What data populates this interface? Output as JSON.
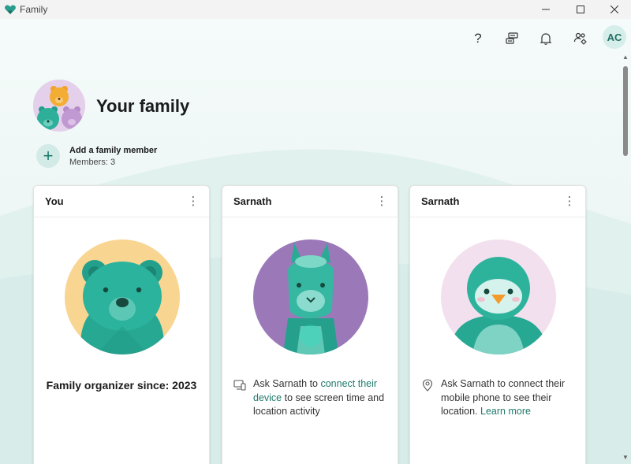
{
  "window": {
    "title": "Family",
    "minimize": "—",
    "maximize": "☐",
    "close": "✕"
  },
  "toolbar": {
    "help": "?",
    "avatar_initials": "AC"
  },
  "family": {
    "title": "Your family",
    "add_member_label": "Add a family member",
    "members": "Members: 3"
  },
  "cards": [
    {
      "name": "You",
      "menu": "⋮",
      "organizer": "Family organizer since: 2023"
    },
    {
      "name": "Sarnath",
      "menu": "⋮",
      "info_before": "Ask Sarnath to ",
      "info_link": "connect their device",
      "info_after": " to see screen time and location activity"
    },
    {
      "name": "Sarnath",
      "menu": "⋮",
      "info_before": "Ask Sarnath to connect their mobile phone to see their location. ",
      "info_link": "Learn more",
      "info_after": ""
    }
  ],
  "colors": {
    "accent": "#1f7a6c",
    "teal_character": "#35b4a0",
    "bear_bg": "#f9d592",
    "llama_bg": "#9b79b9",
    "penguin_bg": "#f3e0ee"
  },
  "icons": {
    "help": "question-icon",
    "feedback": "feedback-icon",
    "notifications": "bell-icon",
    "manage": "manage-family-icon",
    "device": "device-icon",
    "location": "location-pin-icon"
  }
}
